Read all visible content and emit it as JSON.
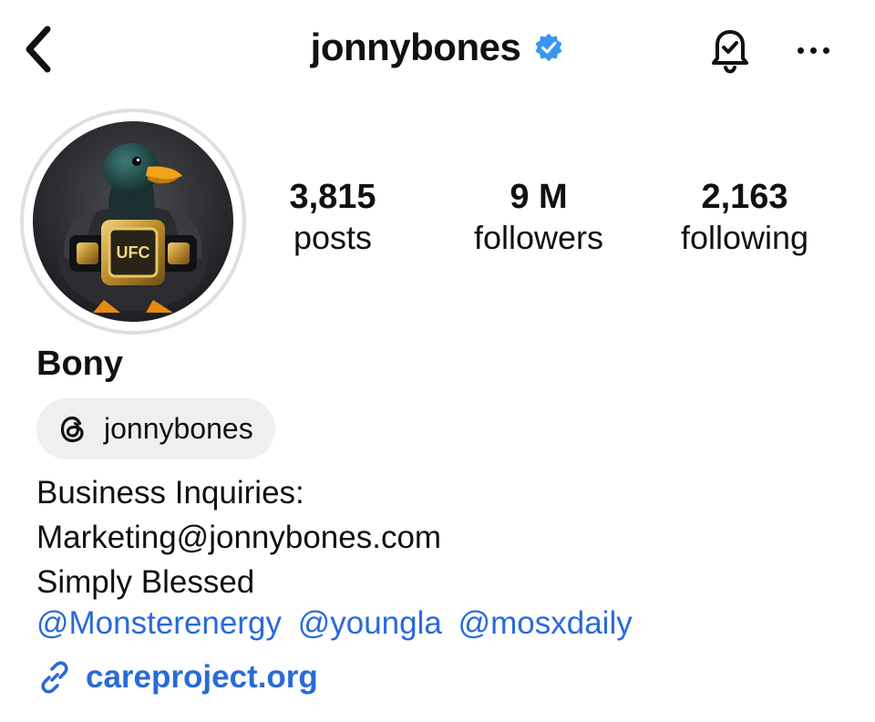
{
  "header": {
    "username": "jonnybones",
    "verified": true,
    "back_icon": "chevron-left-icon",
    "bell_icon": "bell-check-icon",
    "more_icon": "more-horizontal-icon"
  },
  "profile": {
    "avatar": "duck-with-championship-belt",
    "display_name": "Bony",
    "stats": {
      "posts": {
        "value": "3,815",
        "label": "posts"
      },
      "followers": {
        "value": "9 M",
        "label": "followers"
      },
      "following": {
        "value": "2,163",
        "label": "following"
      }
    },
    "threads_handle": "jonnybones",
    "bio": [
      "Business Inquiries:",
      "Marketing@jonnybones.com",
      "Simply Blessed"
    ],
    "mentions": [
      "@Monsterenergy",
      "@youngla",
      "@mosxdaily"
    ],
    "link": "careproject.org"
  },
  "colors": {
    "text": "#111111",
    "link": "#2a6ad8",
    "verified_badge": "#3897f0",
    "chip_bg": "#efeff1"
  }
}
